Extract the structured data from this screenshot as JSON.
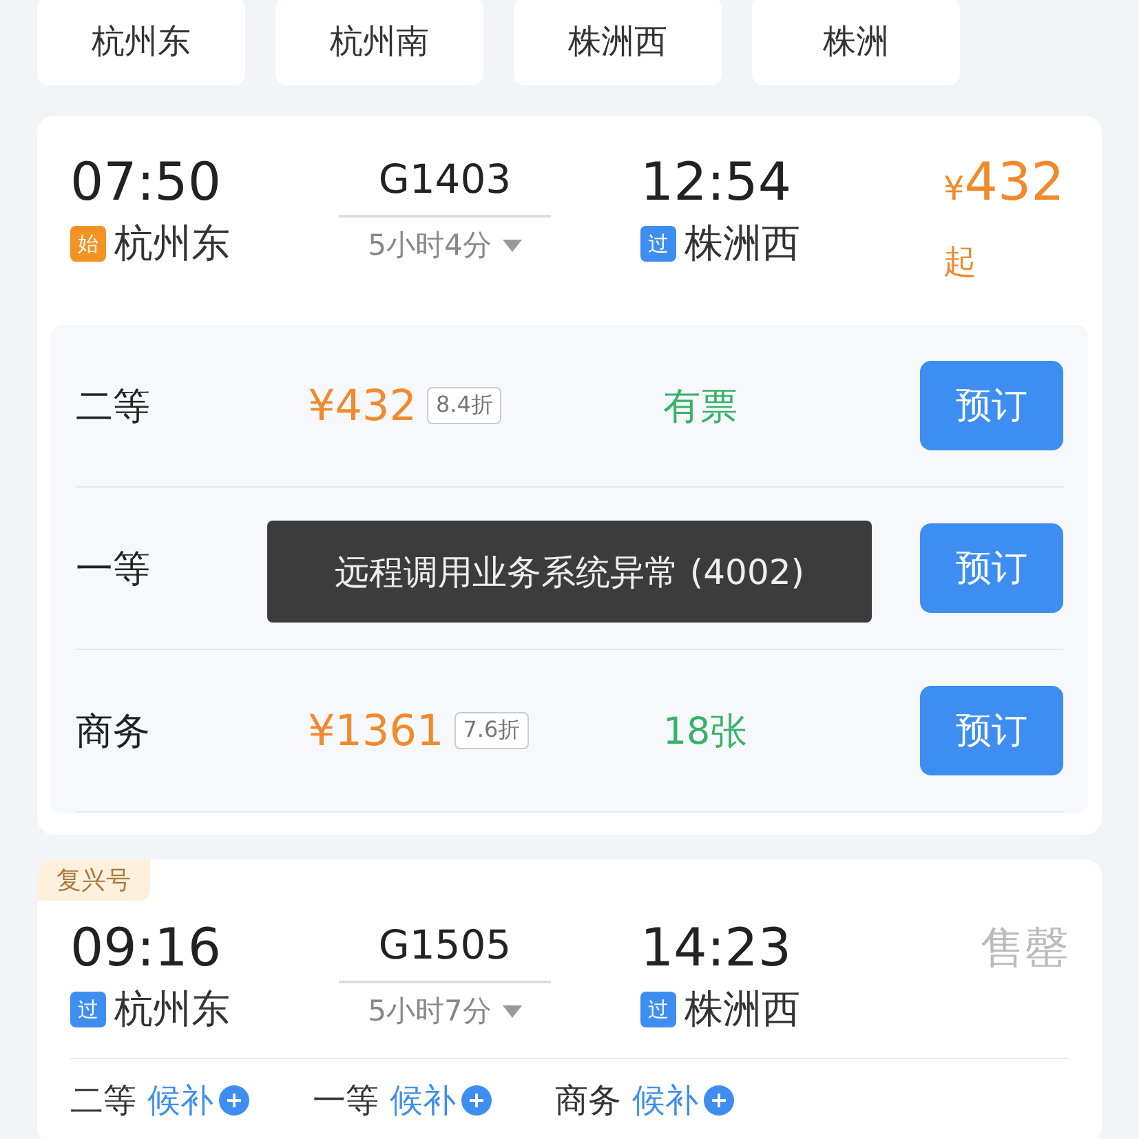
{
  "stations": [
    {
      "label": "杭州东"
    },
    {
      "label": "杭州南"
    },
    {
      "label": "株洲西"
    },
    {
      "label": "株洲"
    }
  ],
  "trains": [
    {
      "depart_time": "07:50",
      "depart_tag": {
        "kind": "start",
        "text": "始"
      },
      "depart_station": "杭州东",
      "number": "G1403",
      "duration": "5小时4分",
      "arrive_time": "12:54",
      "arrive_tag": {
        "kind": "pass",
        "text": "过"
      },
      "arrive_station": "株洲西",
      "price": {
        "currency": "¥",
        "amount": "432",
        "suffix": "起"
      },
      "seats": [
        {
          "class": "二等",
          "price": "¥432",
          "discount": "8.4折",
          "availability": "有票",
          "button": "预订"
        },
        {
          "class": "一等",
          "button": "预订"
        },
        {
          "class": "商务",
          "price": "¥1361",
          "discount": "7.6折",
          "availability": "18张",
          "button": "预订"
        }
      ]
    },
    {
      "ribbon": "复兴号",
      "depart_time": "09:16",
      "depart_tag": {
        "kind": "pass",
        "text": "过"
      },
      "depart_station": "杭州东",
      "number": "G1505",
      "duration": "5小时7分",
      "arrive_time": "14:23",
      "arrive_tag": {
        "kind": "pass",
        "text": "过"
      },
      "arrive_station": "株洲西",
      "status": "售罄",
      "waitlist": [
        {
          "class": "二等",
          "action": "候补"
        },
        {
          "class": "一等",
          "action": "候补"
        },
        {
          "class": "商务",
          "action": "候补"
        }
      ]
    }
  ],
  "toast": "远程调用业务系统异常 (4002)"
}
